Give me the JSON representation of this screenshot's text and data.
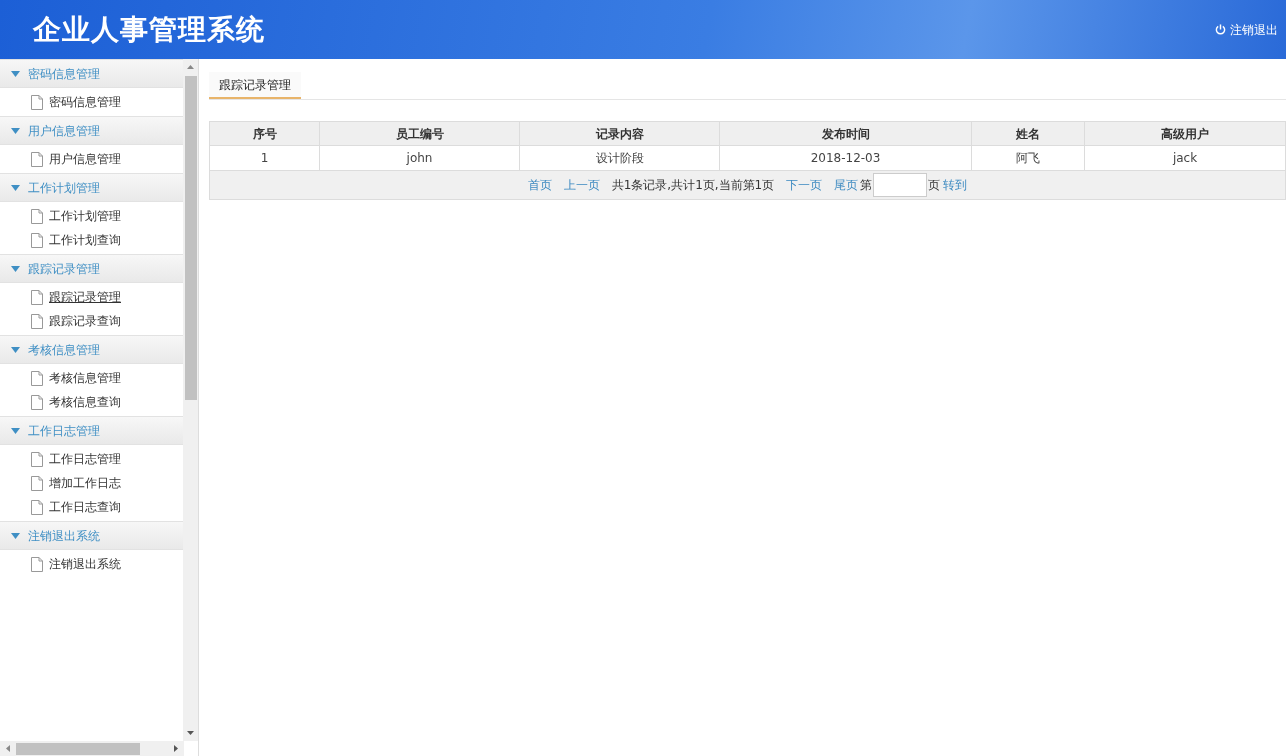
{
  "header": {
    "title": "企业人事管理系统",
    "logout": "注销退出"
  },
  "sidebar": {
    "sections": [
      {
        "label": "密码信息管理",
        "expanded": true,
        "items": [
          {
            "label": "密码信息管理",
            "selected": false
          }
        ]
      },
      {
        "label": "用户信息管理",
        "expanded": true,
        "items": [
          {
            "label": "用户信息管理",
            "selected": false
          }
        ]
      },
      {
        "label": "工作计划管理",
        "expanded": true,
        "items": [
          {
            "label": "工作计划管理",
            "selected": false
          },
          {
            "label": "工作计划查询",
            "selected": false
          }
        ]
      },
      {
        "label": "跟踪记录管理",
        "expanded": true,
        "items": [
          {
            "label": "跟踪记录管理",
            "selected": true
          },
          {
            "label": "跟踪记录查询",
            "selected": false
          }
        ]
      },
      {
        "label": "考核信息管理",
        "expanded": true,
        "items": [
          {
            "label": "考核信息管理",
            "selected": false
          },
          {
            "label": "考核信息查询",
            "selected": false
          }
        ]
      },
      {
        "label": "工作日志管理",
        "expanded": true,
        "items": [
          {
            "label": "工作日志管理",
            "selected": false
          },
          {
            "label": "增加工作日志",
            "selected": false
          },
          {
            "label": "工作日志查询",
            "selected": false
          }
        ]
      },
      {
        "label": "注销退出系统",
        "expanded": true,
        "items": [
          {
            "label": "注销退出系统",
            "selected": false
          }
        ]
      }
    ]
  },
  "tabs": [
    {
      "label": "跟踪记录管理",
      "selected": true
    }
  ],
  "table": {
    "columns": [
      "序号",
      "员工编号",
      "记录内容",
      "发布时间",
      "姓名",
      "高级用户"
    ],
    "rows": [
      [
        "1",
        "john",
        "设计阶段",
        "2018-12-03",
        "阿飞",
        "jack"
      ]
    ]
  },
  "pager": {
    "first": "首页",
    "prev": "上一页",
    "summary": "共1条记录,共计1页,当前第1页",
    "next": "下一页",
    "last": "尾页",
    "page_prefix": "第",
    "page_suffix": "页",
    "go": "转到"
  }
}
